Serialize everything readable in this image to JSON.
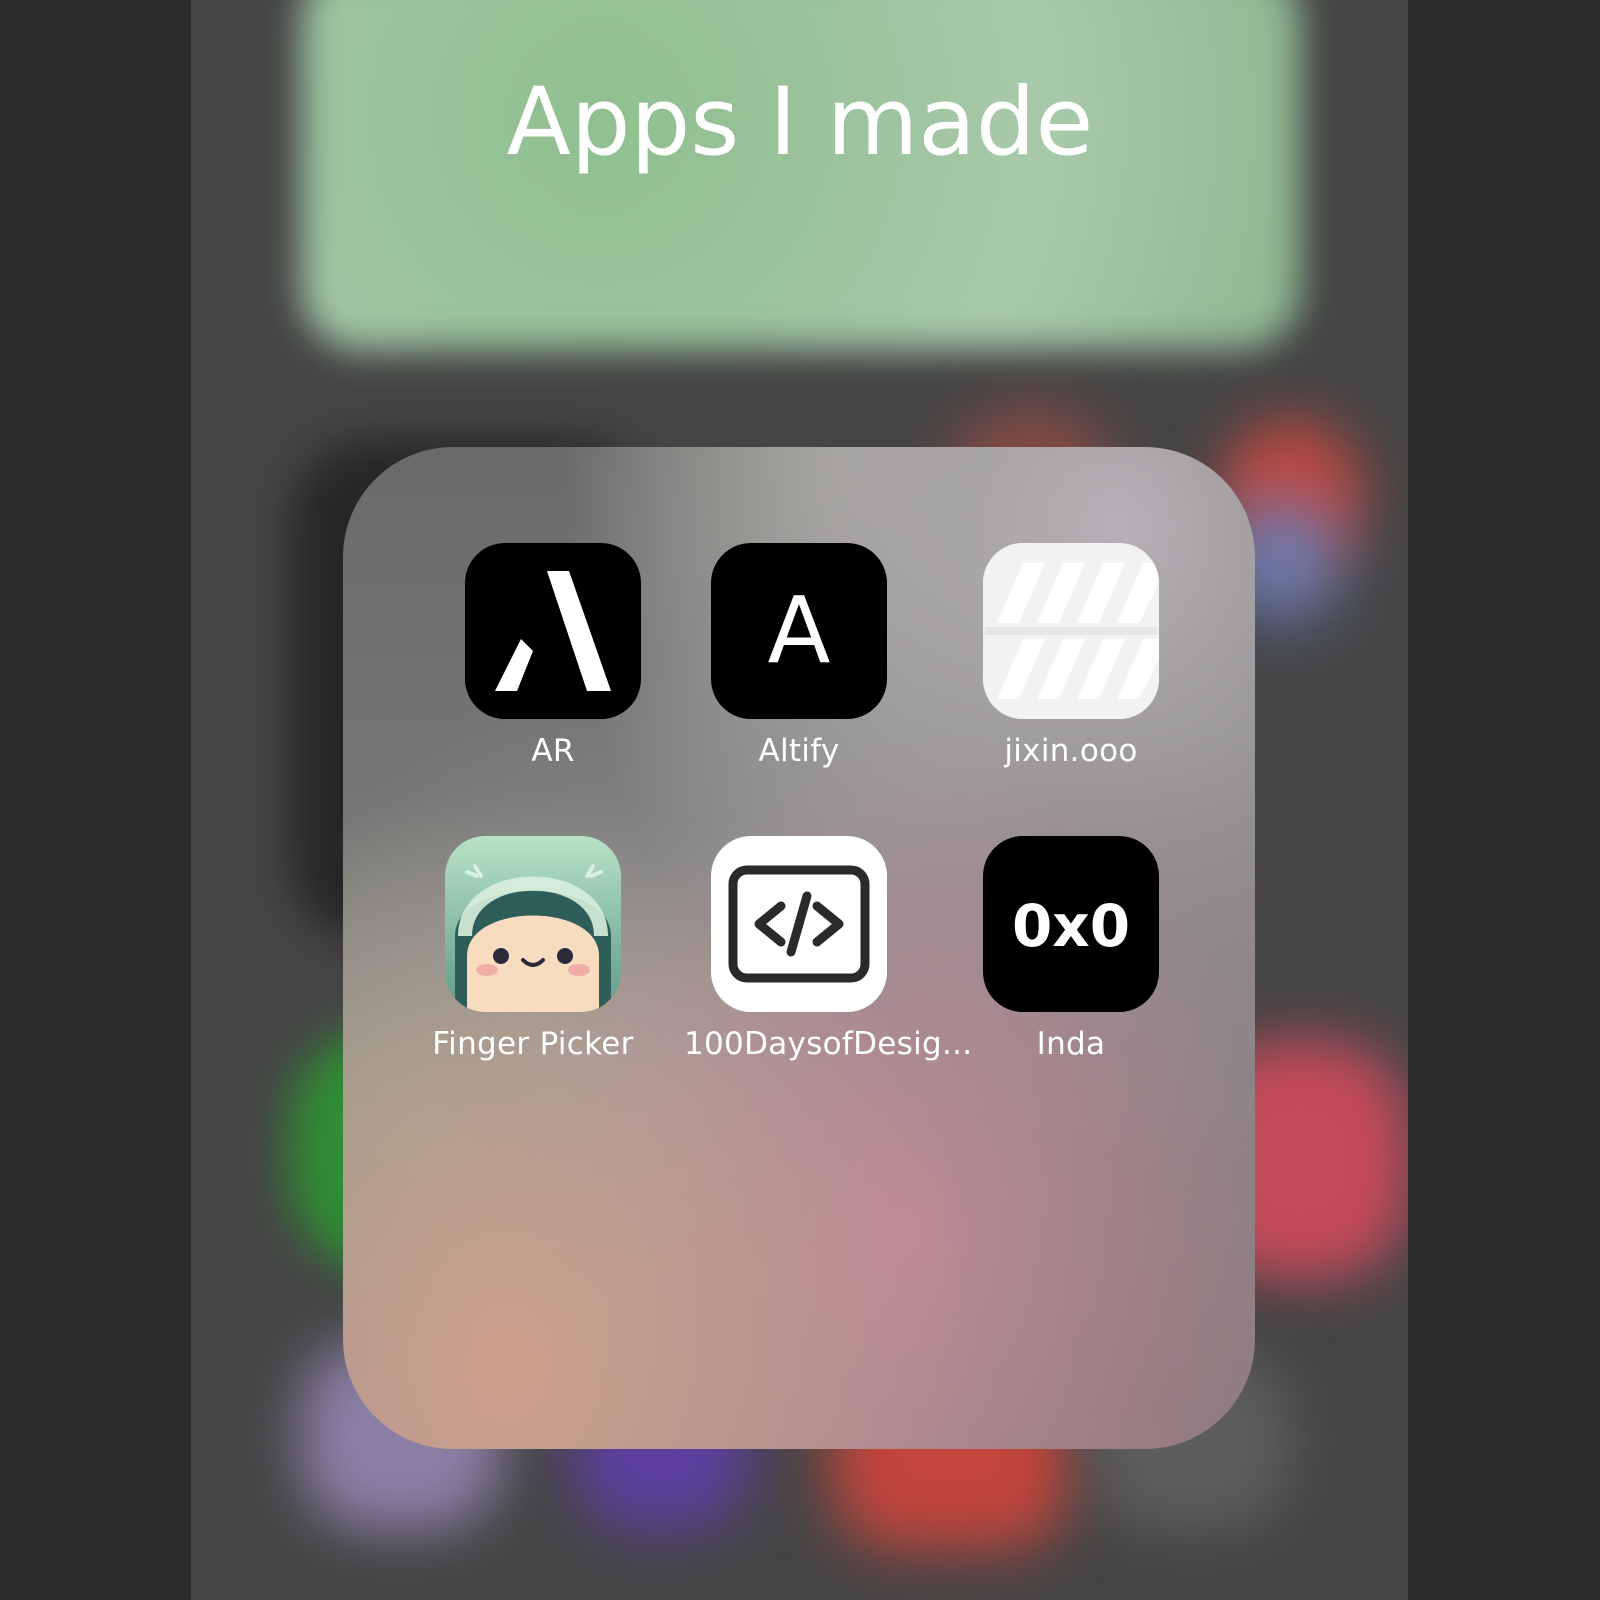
{
  "folder": {
    "title": "Apps I made"
  },
  "apps": [
    {
      "label": "AR",
      "icon": "ar-logo-icon"
    },
    {
      "label": "Altify",
      "icon": "altify-logo-icon",
      "glyph": "A"
    },
    {
      "label": "jixin.ooo",
      "icon": "jixin-logo-icon"
    },
    {
      "label": "Finger Picker",
      "icon": "finger-picker-mascot-icon"
    },
    {
      "label": "100DaysofDesig...",
      "icon": "code-brackets-icon"
    },
    {
      "label": "Inda",
      "icon": "inda-logo-icon",
      "glyph": "0x0"
    }
  ],
  "colors": {
    "background": "#2b2b2b",
    "label": "#ffffff",
    "icon_dark": "#000000",
    "icon_light": "#ffffff",
    "finger_picker_green": "#7fbf9a"
  }
}
